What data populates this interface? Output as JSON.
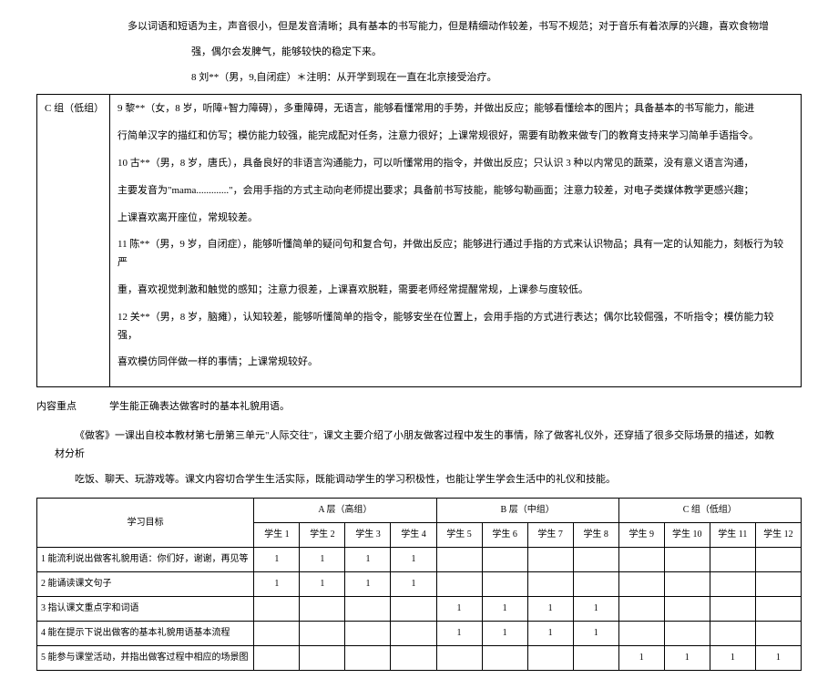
{
  "intro": {
    "line1": "多以词语和短语为主，声音很小，但是发音清晰；具有基本的书写能力，但是精细动作较差，书写不规范；对于音乐有着浓厚的兴趣，喜欢食物增",
    "line2": "强，偶尔会发脾气，能够较快的稳定下来。",
    "line3": "8 刘**（男，9,自闭症）＊注明：从开学到现在一直在北京接受治疗。"
  },
  "group_c": {
    "label": "C 组（低组）",
    "p1": "9 黎**（女，8 岁，听障+智力障碍），多重障碍，无语言，能够看懂常用的手势，并做出反应；能够看懂绘本的图片；具备基本的书写能力，能进",
    "p2": "行简单汉字的描红和仿写；模仿能力较强，能完成配对任务，注意力很好；上课常规很好，需要有助教来做专门的教育支持来学习简单手语指令。",
    "p3": "10 古**（男，8 岁，唐氏），具备良好的非语言沟通能力，可以听懂常用的指令，并做出反应；只认识 3 种以内常见的蔬菜，没有意义语言沟通，",
    "p4": "主要发音为\"mama.............\"，会用手指的方式主动向老师提出要求；具备前书写技能，能够勾勒画面；注意力较差，对电子类媒体教学更感兴趣；",
    "p5": "上课喜欢离开座位，常规较差。",
    "p6": "11 陈**（男，9 岁，自闭症），能够听懂简单的疑问句和复合句，并做出反应；能够进行通过手指的方式来认识物品；具有一定的认知能力，刻板行为较严",
    "p7": "重，喜欢视觉刺激和触觉的感知；注意力很差，上课喜欢脱鞋，需要老师经常提醒常规，上课参与度较低。",
    "p8": "12 关**（男，8 岁，脑瘫），认知较差，能够听懂简单的指令，能够安坐在位置上，会用手指的方式进行表达；偶尔比较倔强，不听指令；模仿能力较强，",
    "p9": "喜欢模仿同伴做一样的事情；上课常规较好。"
  },
  "focus": {
    "label": "内容重点",
    "text": "学生能正确表达做客时的基本礼貌用语。"
  },
  "analysis": {
    "p1": "《做客》一课出自校本教材第七册第三单元\"人际交往\"，课文主要介绍了小朋友做客过程中发生的事情，除了做客礼仪外，还穿插了很多交际场景的描述，如教材分析",
    "p2": "吃饭、聊天、玩游戏等。课文内容切合学生生活实际，既能调动学生的学习积极性，也能让学生学会生活中的礼仪和技能。"
  },
  "table": {
    "header_main": "学习目标",
    "group_a": "A 层（高组）",
    "group_b": "B 层（中组）",
    "group_c": "C 组（低组）",
    "students": [
      "学生 1",
      "学生 2",
      "学生 3",
      "学生 4",
      "学生 5",
      "学生 6",
      "学生 7",
      "学生 8",
      "学生 9",
      "学生 10",
      "学生 11",
      "学生 12"
    ],
    "goals": [
      {
        "text": "1 能流利说出做客礼貌用语：你们好，谢谢，再见等",
        "marks": [
          "1",
          "1",
          "1",
          "1",
          "",
          "",
          "",
          "",
          "",
          "",
          "",
          ""
        ]
      },
      {
        "text": "2 能诵读课文句子",
        "marks": [
          "1",
          "1",
          "1",
          "1",
          "",
          "",
          "",
          "",
          "",
          "",
          "",
          ""
        ]
      },
      {
        "text": "3 指认课文重点字和词语",
        "marks": [
          "",
          "",
          "",
          "",
          "1",
          "1",
          "1",
          "1",
          "",
          "",
          "",
          ""
        ]
      },
      {
        "text": "4 能在提示下说出做客的基本礼貌用语基本流程",
        "marks": [
          "",
          "",
          "",
          "",
          "1",
          "1",
          "1",
          "1",
          "",
          "",
          "",
          ""
        ]
      },
      {
        "text": "5 能参与课堂活动，并指出做客过程中相应的场景图",
        "marks": [
          "",
          "",
          "",
          "",
          "",
          "",
          "",
          "",
          "1",
          "1",
          "1",
          "1"
        ]
      }
    ]
  }
}
